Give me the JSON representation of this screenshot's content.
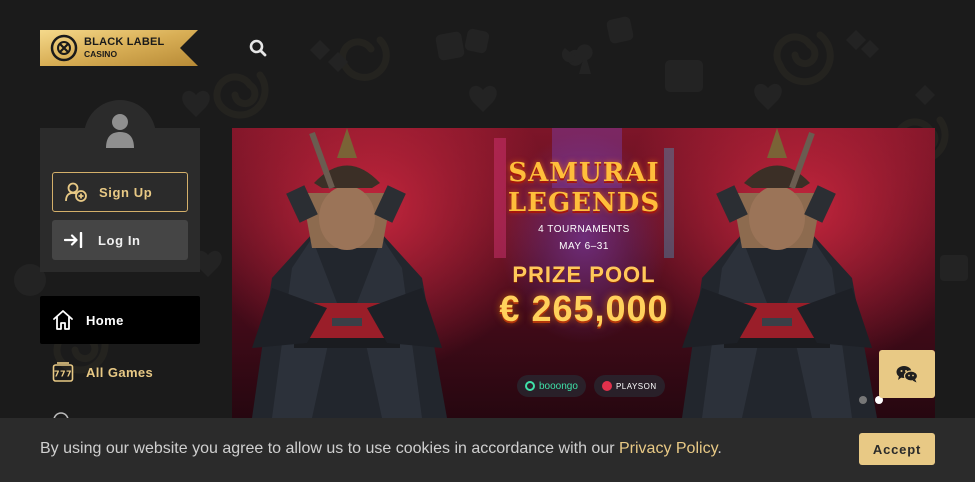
{
  "brand": {
    "name": "BLACK LABEL",
    "subtitle": "CASINO",
    "logo_icon": "roulette-wheel-icon"
  },
  "header": {
    "search_icon": "search-icon"
  },
  "account": {
    "avatar_icon": "user-icon",
    "signup_label": "Sign Up",
    "login_label": "Log In"
  },
  "nav": {
    "items": [
      {
        "label": "Home",
        "icon": "home-icon",
        "active": true
      },
      {
        "label": "All Games",
        "icon": "slot-777-icon",
        "active": false
      }
    ]
  },
  "banner": {
    "title_line1": "SAMURAI",
    "title_line2": "LEGENDS",
    "tournaments": "4 TOURNAMENTS",
    "dates": "MAY 6–31",
    "prize_label": "PRIZE POOL",
    "prize_amount": "€ 265,000",
    "providers": [
      "booongo",
      "PLAYSON"
    ],
    "slides_total": 2,
    "active_slide": 2
  },
  "chat": {
    "icon": "wechat-icon"
  },
  "cookie": {
    "text": "By using our website you agree to allow us to use cookies in accordance with our ",
    "link_text": "Privacy Policy",
    "suffix": ".",
    "accept_label": "Accept"
  },
  "colors": {
    "background": "#1b1b1b",
    "panel": "#2b2b2b",
    "gold": "#e8c985",
    "gold_border": "#d4b06a"
  }
}
